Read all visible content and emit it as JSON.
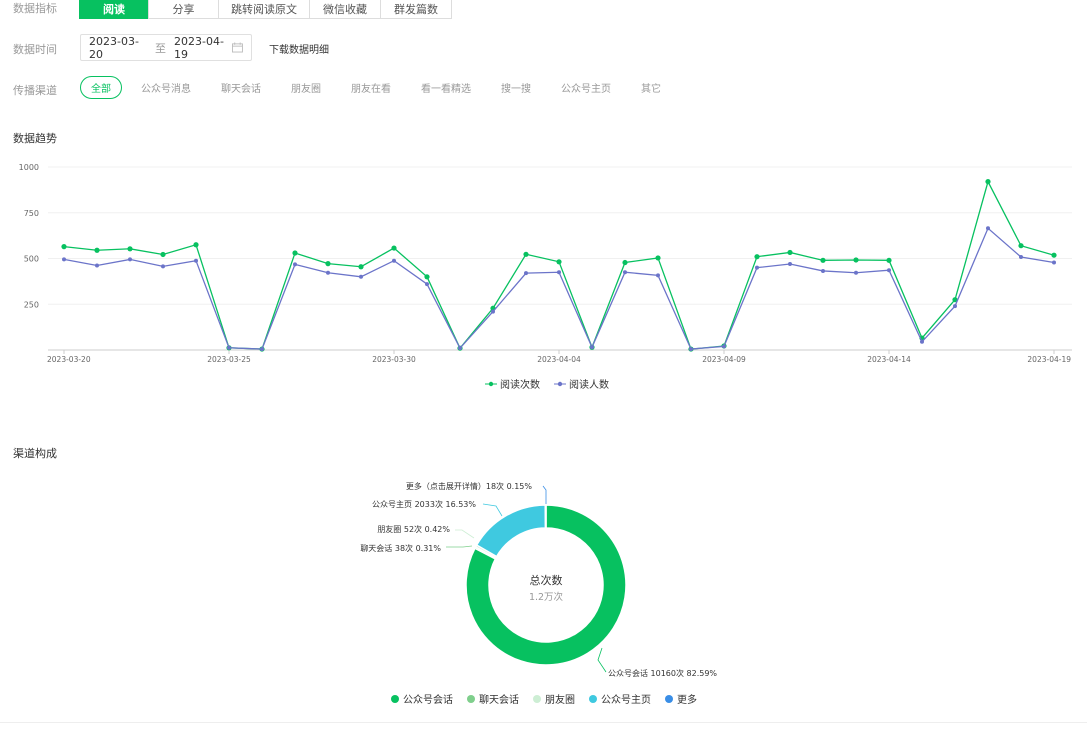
{
  "filters": {
    "metric_label": "数据指标",
    "metrics": [
      "阅读",
      "分享",
      "跳转阅读原文",
      "微信收藏",
      "群发篇数"
    ],
    "time_label": "数据时间",
    "date_from": "2023-03-20",
    "date_sep": "至",
    "date_to": "2023-04-19",
    "download_label": "下载数据明细",
    "channel_label": "传播渠道",
    "channels": [
      "全部",
      "公众号消息",
      "聊天会话",
      "朋友圈",
      "朋友在看",
      "看一看精选",
      "搜一搜",
      "公众号主页",
      "其它"
    ]
  },
  "trend_title": "数据趋势",
  "channel_title": "渠道构成",
  "colors": {
    "accent": "#07c160",
    "reads": "#07c160",
    "readers": "#6b74c9",
    "pie": [
      "#07c160",
      "#7fcf8c",
      "#cdeed4",
      "#3fc9e0",
      "#3a8ee6"
    ]
  },
  "chart_data": [
    {
      "type": "line",
      "title": "",
      "x": [
        "2023-03-20",
        "2023-03-21",
        "2023-03-22",
        "2023-03-23",
        "2023-03-24",
        "2023-03-25",
        "2023-03-26",
        "2023-03-27",
        "2023-03-28",
        "2023-03-29",
        "2023-03-30",
        "2023-03-31",
        "2023-04-01",
        "2023-04-02",
        "2023-04-03",
        "2023-04-04",
        "2023-04-05",
        "2023-04-06",
        "2023-04-07",
        "2023-04-08",
        "2023-04-09",
        "2023-04-10",
        "2023-04-11",
        "2023-04-12",
        "2023-04-13",
        "2023-04-14",
        "2023-04-15",
        "2023-04-16",
        "2023-04-17",
        "2023-04-18",
        "2023-04-19"
      ],
      "xticks": [
        "2023-03-20",
        "2023-03-25",
        "2023-03-30",
        "2023-04-04",
        "2023-04-09",
        "2023-04-14",
        "2023-04-19"
      ],
      "yticks": [
        250,
        500,
        750,
        1000
      ],
      "ylim": [
        0,
        1000
      ],
      "grid": true,
      "legend": "bottom",
      "series": [
        {
          "name": "阅读次数",
          "values": [
            565,
            545,
            553,
            522,
            575,
            12,
            5,
            530,
            472,
            455,
            557,
            400,
            10,
            228,
            523,
            482,
            15,
            478,
            503,
            5,
            22,
            510,
            533,
            490,
            492,
            490,
            65,
            275,
            920,
            570,
            518
          ]
        },
        {
          "name": "阅读人数",
          "values": [
            495,
            462,
            495,
            457,
            488,
            12,
            5,
            468,
            422,
            400,
            488,
            360,
            10,
            210,
            420,
            425,
            15,
            425,
            408,
            5,
            20,
            450,
            470,
            432,
            422,
            436,
            45,
            240,
            665,
            508,
            478
          ]
        }
      ]
    },
    {
      "type": "pie",
      "donut": true,
      "center_title": "总次数",
      "center_value": "1.2万次",
      "legend": "bottom",
      "labels": [
        "公众号会话",
        "聊天会话",
        "朋友圈",
        "公众号主页",
        "更多"
      ],
      "values": [
        10160,
        38,
        52,
        2033,
        18
      ],
      "percents": [
        82.59,
        0.31,
        0.42,
        16.53,
        0.15
      ],
      "slice_labels": [
        "公众号会话 10160次 82.59%",
        "聊天会话 38次 0.31%",
        "朋友圈 52次 0.42%",
        "公众号主页 2033次 16.53%",
        "更多（点击展开详情）18次 0.15%"
      ]
    }
  ]
}
